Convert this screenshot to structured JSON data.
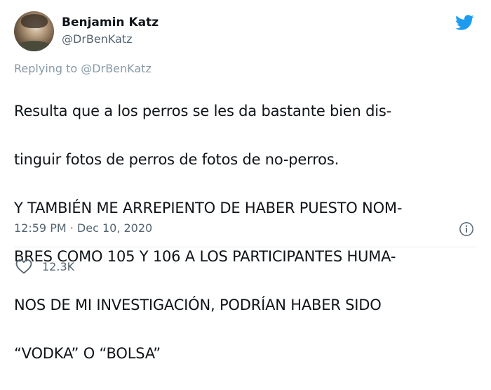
{
  "author": {
    "display_name": "Benjamin Katz",
    "username": "@DrBenKatz"
  },
  "tweet": {
    "replying_to": "Replying to @DrBenKatz",
    "text_lines": [
      "Resulta que a los perros se les da bastante bien dis-",
      "tinguir fotos de perros de fotos de no-perros.",
      "Y TAMBIÉN ME ARREPIENTO DE HABER PUESTO NOM-",
      "BRES COMO 105 Y 106 A LOS PARTICIPANTES HUMA-",
      "NOS DE MI INVESTIGACIÓN, PODRÍAN HABER SIDO",
      "“VODKA” O “BOLSA”"
    ],
    "timestamp": "12:59 PM · Dec 10, 2020"
  },
  "actions": {
    "likes": "12.3K"
  },
  "icons": {
    "brand": "twitter-bird-icon",
    "info": "info-icon",
    "like": "heart-icon"
  },
  "colors": {
    "twitter_blue": "#1d9bf0",
    "secondary_text": "#536471"
  }
}
